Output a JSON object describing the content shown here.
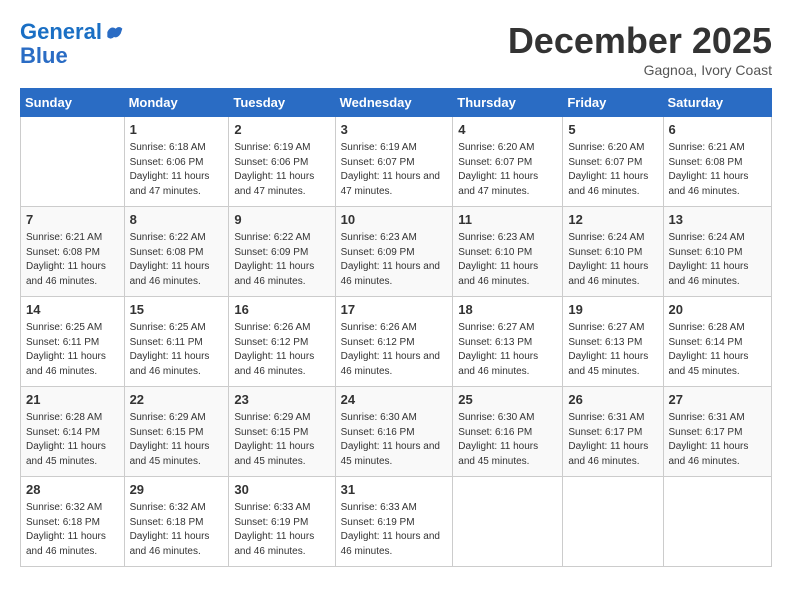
{
  "header": {
    "logo_line1": "General",
    "logo_line2": "Blue",
    "month": "December 2025",
    "location": "Gagnoa, Ivory Coast"
  },
  "weekdays": [
    "Sunday",
    "Monday",
    "Tuesday",
    "Wednesday",
    "Thursday",
    "Friday",
    "Saturday"
  ],
  "weeks": [
    [
      {
        "day": "",
        "sunrise": "",
        "sunset": "",
        "daylight": ""
      },
      {
        "day": "1",
        "sunrise": "Sunrise: 6:18 AM",
        "sunset": "Sunset: 6:06 PM",
        "daylight": "Daylight: 11 hours and 47 minutes."
      },
      {
        "day": "2",
        "sunrise": "Sunrise: 6:19 AM",
        "sunset": "Sunset: 6:06 PM",
        "daylight": "Daylight: 11 hours and 47 minutes."
      },
      {
        "day": "3",
        "sunrise": "Sunrise: 6:19 AM",
        "sunset": "Sunset: 6:07 PM",
        "daylight": "Daylight: 11 hours and 47 minutes."
      },
      {
        "day": "4",
        "sunrise": "Sunrise: 6:20 AM",
        "sunset": "Sunset: 6:07 PM",
        "daylight": "Daylight: 11 hours and 47 minutes."
      },
      {
        "day": "5",
        "sunrise": "Sunrise: 6:20 AM",
        "sunset": "Sunset: 6:07 PM",
        "daylight": "Daylight: 11 hours and 46 minutes."
      },
      {
        "day": "6",
        "sunrise": "Sunrise: 6:21 AM",
        "sunset": "Sunset: 6:08 PM",
        "daylight": "Daylight: 11 hours and 46 minutes."
      }
    ],
    [
      {
        "day": "7",
        "sunrise": "Sunrise: 6:21 AM",
        "sunset": "Sunset: 6:08 PM",
        "daylight": "Daylight: 11 hours and 46 minutes."
      },
      {
        "day": "8",
        "sunrise": "Sunrise: 6:22 AM",
        "sunset": "Sunset: 6:08 PM",
        "daylight": "Daylight: 11 hours and 46 minutes."
      },
      {
        "day": "9",
        "sunrise": "Sunrise: 6:22 AM",
        "sunset": "Sunset: 6:09 PM",
        "daylight": "Daylight: 11 hours and 46 minutes."
      },
      {
        "day": "10",
        "sunrise": "Sunrise: 6:23 AM",
        "sunset": "Sunset: 6:09 PM",
        "daylight": "Daylight: 11 hours and 46 minutes."
      },
      {
        "day": "11",
        "sunrise": "Sunrise: 6:23 AM",
        "sunset": "Sunset: 6:10 PM",
        "daylight": "Daylight: 11 hours and 46 minutes."
      },
      {
        "day": "12",
        "sunrise": "Sunrise: 6:24 AM",
        "sunset": "Sunset: 6:10 PM",
        "daylight": "Daylight: 11 hours and 46 minutes."
      },
      {
        "day": "13",
        "sunrise": "Sunrise: 6:24 AM",
        "sunset": "Sunset: 6:10 PM",
        "daylight": "Daylight: 11 hours and 46 minutes."
      }
    ],
    [
      {
        "day": "14",
        "sunrise": "Sunrise: 6:25 AM",
        "sunset": "Sunset: 6:11 PM",
        "daylight": "Daylight: 11 hours and 46 minutes."
      },
      {
        "day": "15",
        "sunrise": "Sunrise: 6:25 AM",
        "sunset": "Sunset: 6:11 PM",
        "daylight": "Daylight: 11 hours and 46 minutes."
      },
      {
        "day": "16",
        "sunrise": "Sunrise: 6:26 AM",
        "sunset": "Sunset: 6:12 PM",
        "daylight": "Daylight: 11 hours and 46 minutes."
      },
      {
        "day": "17",
        "sunrise": "Sunrise: 6:26 AM",
        "sunset": "Sunset: 6:12 PM",
        "daylight": "Daylight: 11 hours and 46 minutes."
      },
      {
        "day": "18",
        "sunrise": "Sunrise: 6:27 AM",
        "sunset": "Sunset: 6:13 PM",
        "daylight": "Daylight: 11 hours and 46 minutes."
      },
      {
        "day": "19",
        "sunrise": "Sunrise: 6:27 AM",
        "sunset": "Sunset: 6:13 PM",
        "daylight": "Daylight: 11 hours and 45 minutes."
      },
      {
        "day": "20",
        "sunrise": "Sunrise: 6:28 AM",
        "sunset": "Sunset: 6:14 PM",
        "daylight": "Daylight: 11 hours and 45 minutes."
      }
    ],
    [
      {
        "day": "21",
        "sunrise": "Sunrise: 6:28 AM",
        "sunset": "Sunset: 6:14 PM",
        "daylight": "Daylight: 11 hours and 45 minutes."
      },
      {
        "day": "22",
        "sunrise": "Sunrise: 6:29 AM",
        "sunset": "Sunset: 6:15 PM",
        "daylight": "Daylight: 11 hours and 45 minutes."
      },
      {
        "day": "23",
        "sunrise": "Sunrise: 6:29 AM",
        "sunset": "Sunset: 6:15 PM",
        "daylight": "Daylight: 11 hours and 45 minutes."
      },
      {
        "day": "24",
        "sunrise": "Sunrise: 6:30 AM",
        "sunset": "Sunset: 6:16 PM",
        "daylight": "Daylight: 11 hours and 45 minutes."
      },
      {
        "day": "25",
        "sunrise": "Sunrise: 6:30 AM",
        "sunset": "Sunset: 6:16 PM",
        "daylight": "Daylight: 11 hours and 45 minutes."
      },
      {
        "day": "26",
        "sunrise": "Sunrise: 6:31 AM",
        "sunset": "Sunset: 6:17 PM",
        "daylight": "Daylight: 11 hours and 46 minutes."
      },
      {
        "day": "27",
        "sunrise": "Sunrise: 6:31 AM",
        "sunset": "Sunset: 6:17 PM",
        "daylight": "Daylight: 11 hours and 46 minutes."
      }
    ],
    [
      {
        "day": "28",
        "sunrise": "Sunrise: 6:32 AM",
        "sunset": "Sunset: 6:18 PM",
        "daylight": "Daylight: 11 hours and 46 minutes."
      },
      {
        "day": "29",
        "sunrise": "Sunrise: 6:32 AM",
        "sunset": "Sunset: 6:18 PM",
        "daylight": "Daylight: 11 hours and 46 minutes."
      },
      {
        "day": "30",
        "sunrise": "Sunrise: 6:33 AM",
        "sunset": "Sunset: 6:19 PM",
        "daylight": "Daylight: 11 hours and 46 minutes."
      },
      {
        "day": "31",
        "sunrise": "Sunrise: 6:33 AM",
        "sunset": "Sunset: 6:19 PM",
        "daylight": "Daylight: 11 hours and 46 minutes."
      },
      {
        "day": "",
        "sunrise": "",
        "sunset": "",
        "daylight": ""
      },
      {
        "day": "",
        "sunrise": "",
        "sunset": "",
        "daylight": ""
      },
      {
        "day": "",
        "sunrise": "",
        "sunset": "",
        "daylight": ""
      }
    ]
  ]
}
